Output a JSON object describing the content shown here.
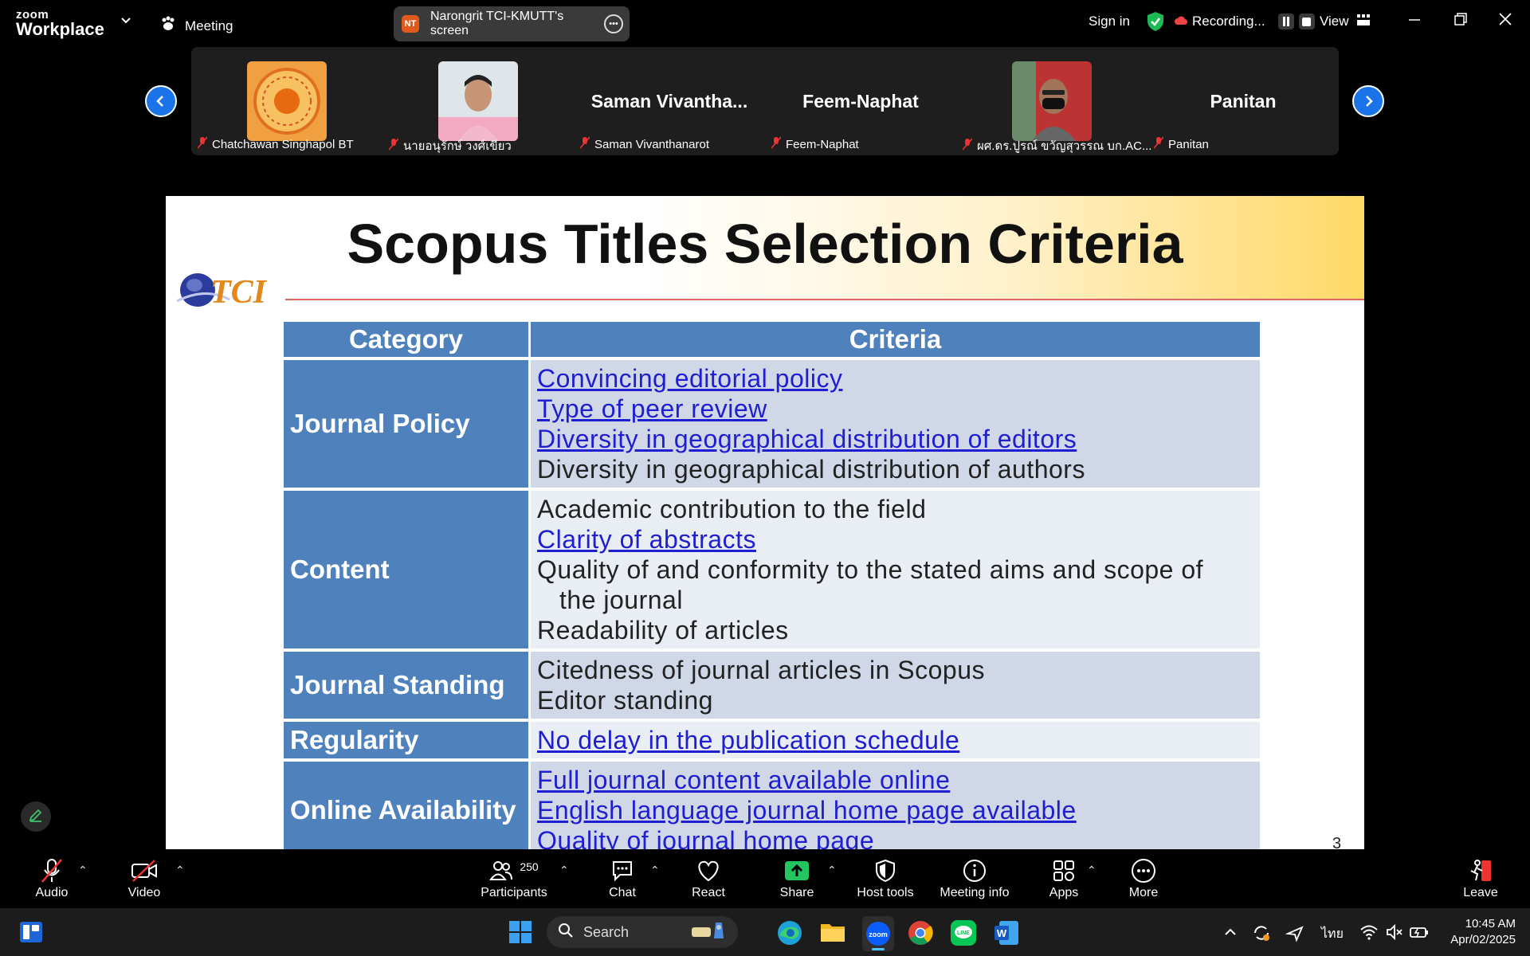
{
  "app": {
    "brand_top": "zoom",
    "brand_bottom": "Workplace",
    "meeting_label": "Meeting",
    "share_badge": "NT",
    "share_title": "Narongrit TCI-KMUTT's screen",
    "sign_in": "Sign in",
    "recording_label": "Recording...",
    "view_label": "View"
  },
  "participants": [
    {
      "label": "Chatchawan Singhapol BT",
      "display": "",
      "kind": "logo"
    },
    {
      "label": "นายอนุรักษ์ วงศ์เขียว",
      "display": "",
      "kind": "photo"
    },
    {
      "label": "Saman Vivanthanarot",
      "display": "Saman  Vivantha...",
      "kind": "name"
    },
    {
      "label": "Feem-Naphat",
      "display": "Feem-Naphat",
      "kind": "name"
    },
    {
      "label": "ผศ.ดร.ปูรณ์ ขวัญสุวรรณ บก.AC...",
      "display": "",
      "kind": "photo"
    },
    {
      "label": "Panitan",
      "display": "Panitan",
      "kind": "name"
    }
  ],
  "slide": {
    "title": "Scopus Titles Selection Criteria",
    "logo_text": "TCI",
    "header_category": "Category",
    "header_criteria": "Criteria",
    "page_number": "3",
    "rows": [
      {
        "category": "Journal Policy",
        "items": [
          {
            "text": "Convincing editorial policy",
            "link": true
          },
          {
            "text": "Type of peer review",
            "link": true
          },
          {
            "text": "Diversity in geographical distribution of editors",
            "link": true
          },
          {
            "text": "Diversity in geographical distribution of authors",
            "link": false
          }
        ]
      },
      {
        "category": "Content",
        "items": [
          {
            "text": "Academic contribution to the field",
            "link": false
          },
          {
            "text": "Clarity of abstracts",
            "link": true
          },
          {
            "text": "Quality of and conformity to the stated aims and scope of",
            "link": false
          },
          {
            "text": "the journal",
            "link": false,
            "indent": true
          },
          {
            "text": "Readability of articles",
            "link": false
          }
        ]
      },
      {
        "category": "Journal Standing",
        "items": [
          {
            "text": "Citedness of journal articles in Scopus",
            "link": false
          },
          {
            "text": "Editor standing",
            "link": false
          }
        ]
      },
      {
        "category": "Regularity",
        "items": [
          {
            "text": "No delay in the publication schedule",
            "link": true
          }
        ]
      },
      {
        "category": "Online Availability",
        "items": [
          {
            "text": "Full journal content available online",
            "link": true
          },
          {
            "text": "English language journal home page available",
            "link": true
          },
          {
            "text": "Quality of journal home page",
            "link": true
          }
        ]
      }
    ]
  },
  "toolbar": {
    "audio": "Audio",
    "video": "Video",
    "participants": "Participants",
    "participants_count": "250",
    "chat": "Chat",
    "react": "React",
    "share": "Share",
    "host_tools": "Host tools",
    "meeting_info": "Meeting info",
    "apps": "Apps",
    "more": "More",
    "leave": "Leave"
  },
  "taskbar": {
    "search_placeholder": "Search",
    "language": "ไทย",
    "time": "10:45 AM",
    "date": "Apr/02/2025"
  },
  "colors": {
    "accent_blue": "#1a73e8",
    "table_header": "#4f81bd",
    "row_dark": "#d0d8e8",
    "row_light": "#e9edf4",
    "link": "#1f1fd1",
    "shield_green": "#1db954",
    "share_green": "#22c55e"
  }
}
